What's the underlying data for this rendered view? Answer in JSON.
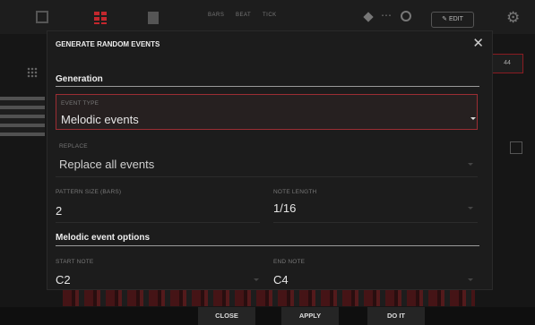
{
  "background": {
    "toolbar": {
      "mini_labels": [
        "BARS",
        "BEAT",
        "TICK"
      ],
      "edit_label": "EDIT"
    },
    "side_button_label": "44"
  },
  "dialog": {
    "title": "GENERATE RANDOM EVENTS",
    "close_glyph": "✕",
    "generation": {
      "heading": "Generation",
      "event_type": {
        "label": "EVENT TYPE",
        "value": "Melodic events"
      },
      "replace": {
        "label": "REPLACE",
        "value": "Replace all events"
      },
      "pattern_size": {
        "label": "PATTERN SIZE (BARS)",
        "value": "2"
      },
      "note_length": {
        "label": "NOTE LENGTH",
        "value": "1/16"
      }
    },
    "melodic_options": {
      "heading": "Melodic event options",
      "start_note": {
        "label": "START NOTE",
        "value": "C2"
      },
      "end_note": {
        "label": "END NOTE",
        "value": "C4"
      }
    }
  },
  "bottom_bar": {
    "close_label": "CLOSE",
    "apply_label": "APPLY",
    "do_it_label": "DO IT"
  },
  "colors": {
    "accent_red": "#c3272d",
    "focus_border": "#9b2d33"
  },
  "icons": [
    "grid-icon",
    "gear-icon",
    "close-icon",
    "chevron-down-icon",
    "edit-icon"
  ]
}
